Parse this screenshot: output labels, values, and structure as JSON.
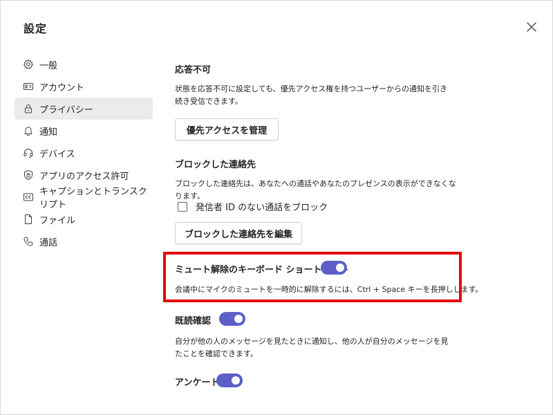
{
  "dialog": {
    "title": "設定"
  },
  "colors": {
    "toggle_on": "#5b5fc7",
    "highlight": "#e8000b",
    "active_bg": "#ebebeb"
  },
  "sidebar": {
    "items": [
      {
        "label": "一般",
        "icon": "gear-icon"
      },
      {
        "label": "アカウント",
        "icon": "id-card-icon"
      },
      {
        "label": "プライバシー",
        "icon": "lock-icon",
        "active": true
      },
      {
        "label": "通知",
        "icon": "bell-icon"
      },
      {
        "label": "デバイス",
        "icon": "headset-icon"
      },
      {
        "label": "アプリのアクセス許可",
        "icon": "shield-icon"
      },
      {
        "label": "キャプションとトランスクリプト",
        "icon": "cc-icon"
      },
      {
        "label": "ファイル",
        "icon": "file-icon"
      },
      {
        "label": "通話",
        "icon": "phone-icon"
      }
    ]
  },
  "dnd": {
    "heading": "応答不可",
    "description": "状態を応答不可に設定しても、優先アクセス権を持つユーザーからの通知を引き続き受信できます。",
    "button": "優先アクセスを管理"
  },
  "blocked": {
    "heading": "ブロックした連絡先",
    "description": "ブロックした連絡先は、あなたへの通話やあなたのプレゼンスの表示ができなくなります。",
    "checkbox_label": "発信者 ID のない通話をブロック",
    "checkbox_checked": false,
    "button": "ブロックした連絡先を編集"
  },
  "mute_shortcut": {
    "heading": "ミュート解除のキーボード ショートカット",
    "toggle_on": true,
    "description": "会議中にマイクのミュートを一時的に解除するには、Ctrl + Space キーを長押しします。"
  },
  "read_receipts": {
    "heading": "既読確認",
    "toggle_on": true,
    "description": "自分が他の人のメッセージを見たときに通知し、他の人が自分のメッセージを見たことを確認できます。"
  },
  "survey": {
    "heading": "アンケート",
    "toggle_on": true
  }
}
